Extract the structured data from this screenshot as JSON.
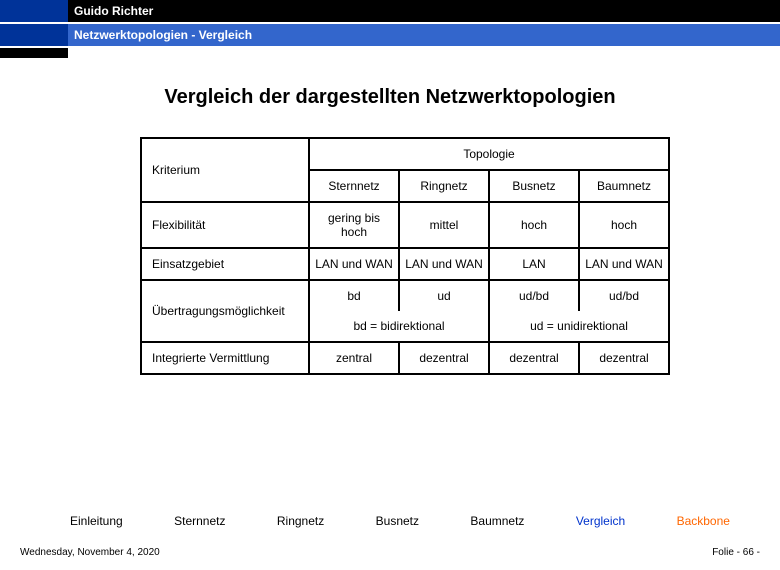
{
  "header": {
    "author": "Guido Richter",
    "breadcrumb": "Netzwerktopologien  - Vergleich"
  },
  "slide": {
    "title": "Vergleich der dargestellten Netzwerktopologien"
  },
  "table": {
    "kriterium_label": "Kriterium",
    "topologie_label": "Topologie",
    "columns": [
      "Sternnetz",
      "Ringnetz",
      "Busnetz",
      "Baumnetz"
    ],
    "rows": {
      "flex": {
        "label": "Flexibilität",
        "cells": [
          "gering bis hoch",
          "mittel",
          "hoch",
          "hoch"
        ]
      },
      "einsatz": {
        "label": "Einsatzgebiet",
        "cells": [
          "LAN und WAN",
          "LAN und WAN",
          "LAN",
          "LAN und WAN"
        ]
      },
      "trans_top": {
        "label": "",
        "cells": [
          "bd",
          "ud",
          "ud/bd",
          "ud/bd"
        ]
      },
      "trans_label": "Übertragungsmöglichkeit",
      "trans_legend": [
        "bd = bidirektional",
        "ud = unidirektional"
      ],
      "integ": {
        "label": "Integrierte Vermittlung",
        "cells": [
          "zentral",
          "dezentral",
          "dezentral",
          "dezentral"
        ]
      }
    }
  },
  "nav": {
    "items": [
      "Einleitung",
      "Sternnetz",
      "Ringnetz",
      "Busnetz",
      "Baumnetz",
      "Vergleich",
      "Backbone"
    ]
  },
  "footer": {
    "date": "Wednesday, November 4, 2020",
    "page": "Folie - 66 -"
  }
}
